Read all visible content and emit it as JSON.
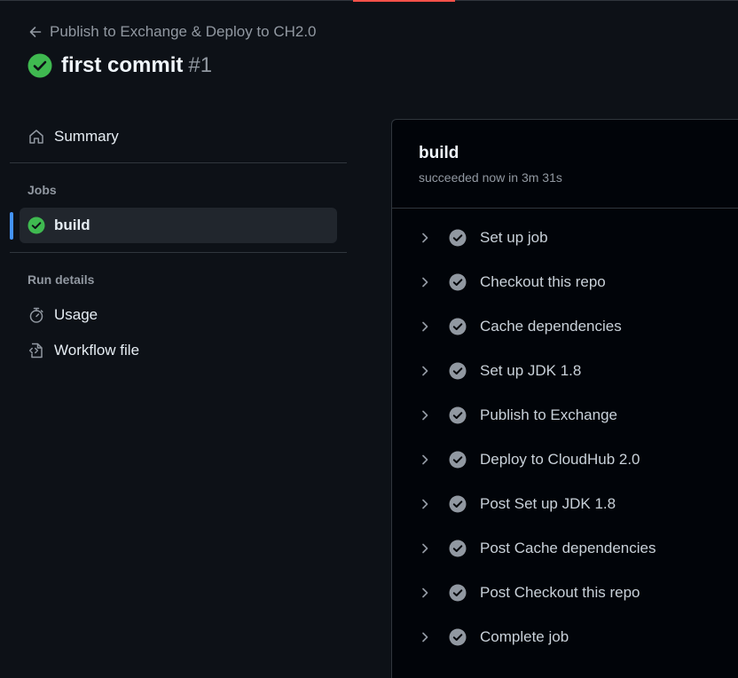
{
  "colors": {
    "background": "#0d1117",
    "panel": "#010409",
    "border": "#30363d",
    "success": "#3fb950",
    "step_check": "#9198a1",
    "accent": "#4493f8",
    "muted_text": "#9198a1"
  },
  "header": {
    "back_icon": "arrow-left-icon",
    "back_label": "Publish to Exchange & Deploy to CH2.0",
    "status_icon": "check-circle-fill-icon",
    "title": "first commit",
    "run_number": "#1"
  },
  "sidebar": {
    "summary": {
      "icon": "home-icon",
      "label": "Summary"
    },
    "jobs_heading": "Jobs",
    "jobs": [
      {
        "icon": "check-circle-fill-icon",
        "label": "build",
        "active": true
      }
    ],
    "run_details_heading": "Run details",
    "run_details": [
      {
        "icon": "stopwatch-icon",
        "label": "Usage"
      },
      {
        "icon": "file-code-icon",
        "label": "Workflow file"
      }
    ]
  },
  "job": {
    "title": "build",
    "status": "succeeded now in 3m 31s",
    "steps": [
      {
        "label": "Set up job"
      },
      {
        "label": "Checkout this repo"
      },
      {
        "label": "Cache dependencies"
      },
      {
        "label": "Set up JDK 1.8"
      },
      {
        "label": "Publish to Exchange"
      },
      {
        "label": "Deploy to CloudHub 2.0"
      },
      {
        "label": "Post Set up JDK 1.8"
      },
      {
        "label": "Post Cache dependencies"
      },
      {
        "label": "Post Checkout this repo"
      },
      {
        "label": "Complete job"
      }
    ]
  }
}
